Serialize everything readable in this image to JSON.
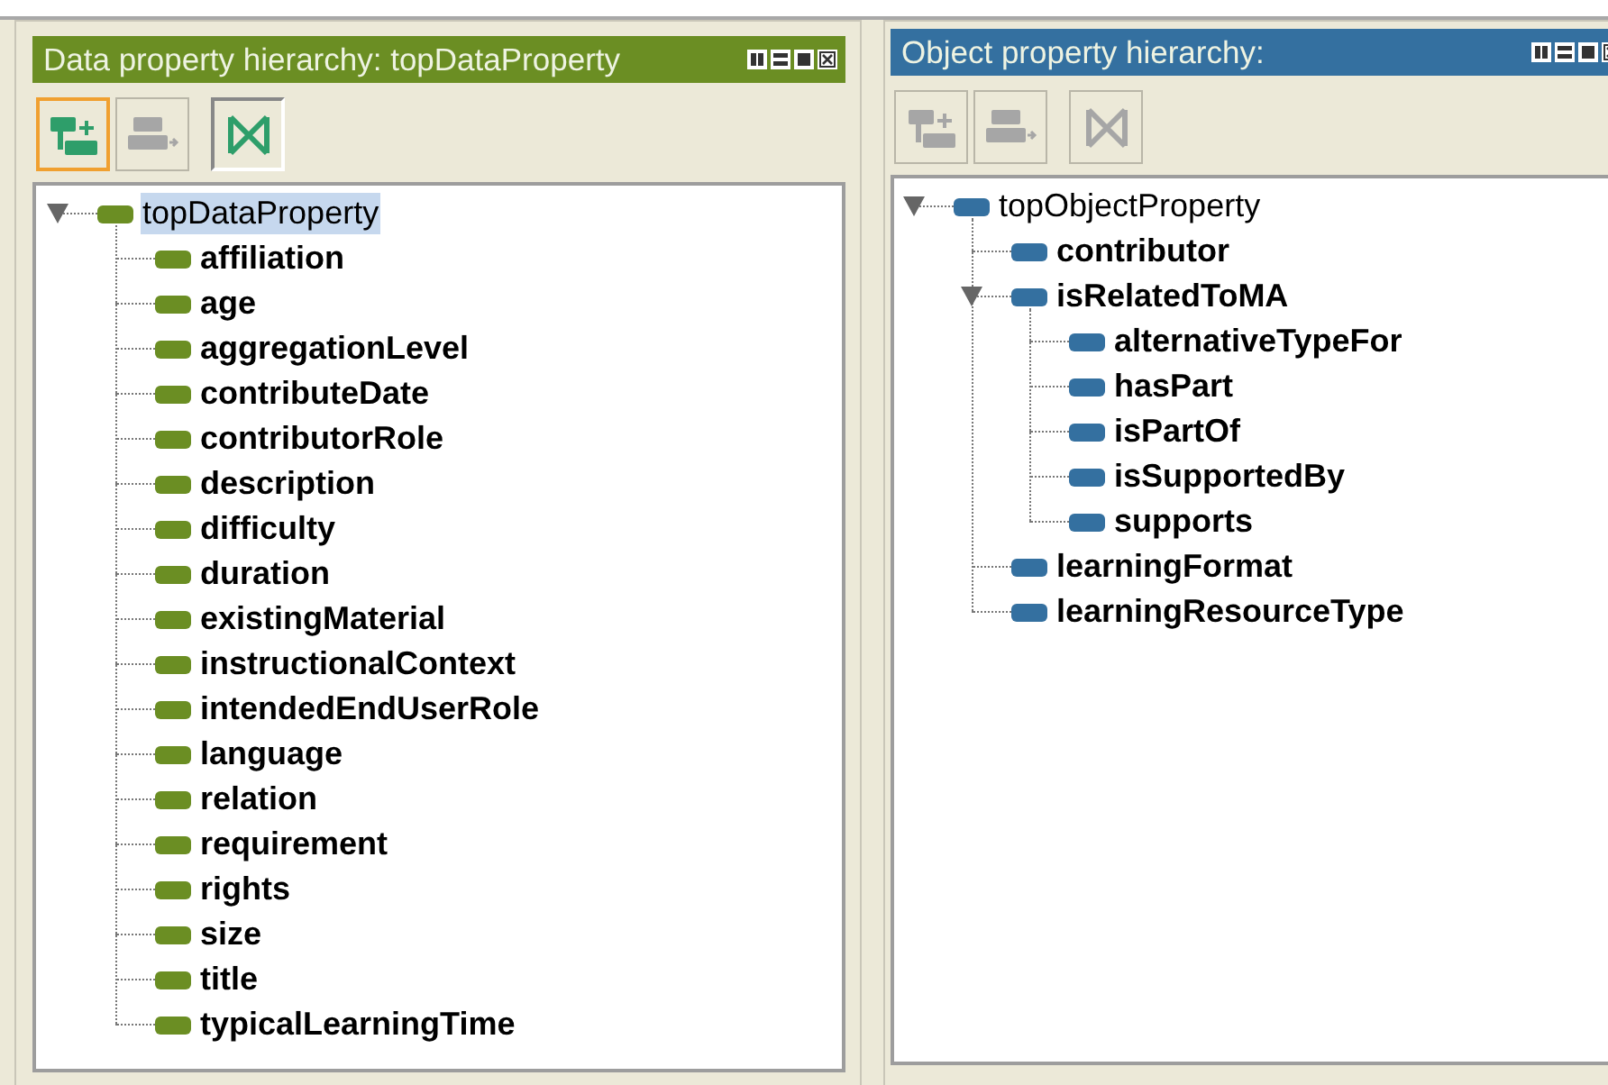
{
  "panels": [
    {
      "title": "Data property hierarchy: topDataProperty",
      "color": "#6b8e23",
      "tools": [
        {
          "kind": "add-sub",
          "disabled": false,
          "focused": true
        },
        {
          "kind": "add-sibling",
          "disabled": true,
          "focused": false
        },
        {
          "kind": "delete",
          "disabled": false,
          "focused": false
        }
      ],
      "tree": [
        {
          "label": "topDataProperty",
          "bold": false,
          "selected": true,
          "expanded": true,
          "children": [
            {
              "label": "affiliation",
              "bold": true,
              "selected": false
            },
            {
              "label": "age",
              "bold": true,
              "selected": false
            },
            {
              "label": "aggregationLevel",
              "bold": true,
              "selected": false
            },
            {
              "label": "contributeDate",
              "bold": true,
              "selected": false
            },
            {
              "label": "contributorRole",
              "bold": true,
              "selected": false
            },
            {
              "label": "description",
              "bold": true,
              "selected": false
            },
            {
              "label": "difficulty",
              "bold": true,
              "selected": false
            },
            {
              "label": "duration",
              "bold": true,
              "selected": false
            },
            {
              "label": "existingMaterial",
              "bold": true,
              "selected": false
            },
            {
              "label": "instructionalContext",
              "bold": true,
              "selected": false
            },
            {
              "label": "intendedEndUserRole",
              "bold": true,
              "selected": false
            },
            {
              "label": "language",
              "bold": true,
              "selected": false
            },
            {
              "label": "relation",
              "bold": true,
              "selected": false
            },
            {
              "label": "requirement",
              "bold": true,
              "selected": false
            },
            {
              "label": "rights",
              "bold": true,
              "selected": false
            },
            {
              "label": "size",
              "bold": true,
              "selected": false
            },
            {
              "label": "title",
              "bold": true,
              "selected": false
            },
            {
              "label": "typicalLearningTime",
              "bold": true,
              "selected": false
            }
          ]
        }
      ]
    },
    {
      "title": "Object property hierarchy:",
      "color": "#3470a0",
      "tools": [
        {
          "kind": "add-sub",
          "disabled": true,
          "focused": false
        },
        {
          "kind": "add-sibling",
          "disabled": true,
          "focused": false
        },
        {
          "kind": "delete",
          "disabled": true,
          "focused": false
        }
      ],
      "tree": [
        {
          "label": "topObjectProperty",
          "bold": false,
          "selected": false,
          "expanded": true,
          "children": [
            {
              "label": "contributor",
              "bold": true,
              "selected": false
            },
            {
              "label": "isRelatedToMA",
              "bold": true,
              "selected": false,
              "expanded": true,
              "children": [
                {
                  "label": "alternativeTypeFor",
                  "bold": true,
                  "selected": false
                },
                {
                  "label": "hasPart",
                  "bold": true,
                  "selected": false
                },
                {
                  "label": "isPartOf",
                  "bold": true,
                  "selected": false
                },
                {
                  "label": "isSupportedBy",
                  "bold": true,
                  "selected": false
                },
                {
                  "label": "supports",
                  "bold": true,
                  "selected": false
                }
              ]
            },
            {
              "label": "learningFormat",
              "bold": true,
              "selected": false
            },
            {
              "label": "learningResourceType",
              "bold": true,
              "selected": false
            }
          ]
        }
      ]
    }
  ]
}
